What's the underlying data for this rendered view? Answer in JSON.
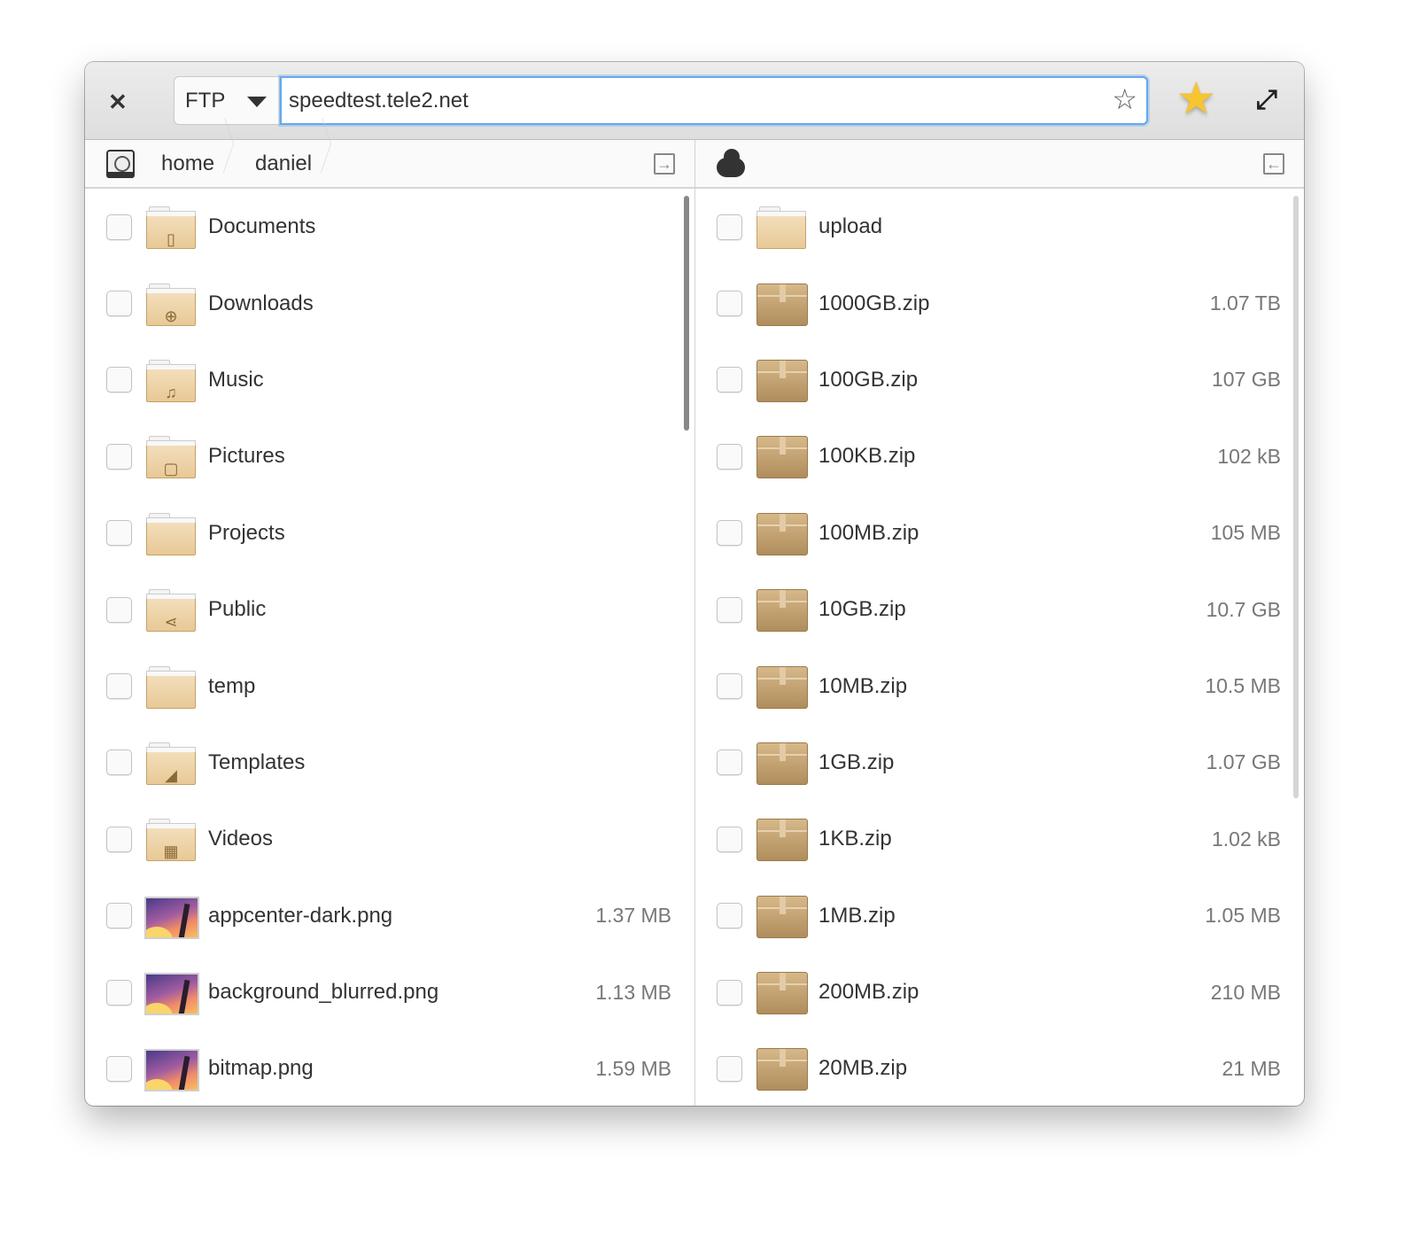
{
  "header": {
    "close_icon": "close-icon",
    "protocol": "FTP",
    "url": "speedtest.tele2.net",
    "bookmark_icon": "star-outline-icon",
    "bookmarks_icon": "star-filled-icon",
    "maximize_icon": "maximize-icon",
    "accent_color": "#64a8ef"
  },
  "left_pane": {
    "breadcrumb": [
      "home",
      "daniel"
    ],
    "scroll_fraction": 0.25,
    "items": [
      {
        "name": "Documents",
        "type": "folder",
        "glyph": "▯",
        "size": ""
      },
      {
        "name": "Downloads",
        "type": "folder",
        "glyph": "⊕",
        "size": ""
      },
      {
        "name": "Music",
        "type": "folder",
        "glyph": "♫",
        "size": ""
      },
      {
        "name": "Pictures",
        "type": "folder",
        "glyph": "▢",
        "size": ""
      },
      {
        "name": "Projects",
        "type": "folder",
        "glyph": "",
        "size": ""
      },
      {
        "name": "Public",
        "type": "folder",
        "glyph": "⋖",
        "size": ""
      },
      {
        "name": "temp",
        "type": "folder",
        "glyph": "",
        "size": ""
      },
      {
        "name": "Templates",
        "type": "folder",
        "glyph": "◢",
        "size": ""
      },
      {
        "name": "Videos",
        "type": "folder",
        "glyph": "▦",
        "size": ""
      },
      {
        "name": "appcenter-dark.png",
        "type": "image",
        "glyph": "",
        "size": "1.37 MB"
      },
      {
        "name": "background_blurred.png",
        "type": "image",
        "glyph": "",
        "size": "1.13 MB"
      },
      {
        "name": "bitmap.png",
        "type": "image",
        "glyph": "",
        "size": "1.59 MB"
      }
    ]
  },
  "right_pane": {
    "location_icon": "cloud-icon",
    "scroll_fraction": 0.66,
    "items": [
      {
        "name": "upload",
        "type": "folder",
        "glyph": "",
        "size": ""
      },
      {
        "name": "1000GB.zip",
        "type": "archive",
        "glyph": "",
        "size": "1.07 TB"
      },
      {
        "name": "100GB.zip",
        "type": "archive",
        "glyph": "",
        "size": "107 GB"
      },
      {
        "name": "100KB.zip",
        "type": "archive",
        "glyph": "",
        "size": "102 kB"
      },
      {
        "name": "100MB.zip",
        "type": "archive",
        "glyph": "",
        "size": "105 MB"
      },
      {
        "name": "10GB.zip",
        "type": "archive",
        "glyph": "",
        "size": "10.7 GB"
      },
      {
        "name": "10MB.zip",
        "type": "archive",
        "glyph": "",
        "size": "10.5 MB"
      },
      {
        "name": "1GB.zip",
        "type": "archive",
        "glyph": "",
        "size": "1.07 GB"
      },
      {
        "name": "1KB.zip",
        "type": "archive",
        "glyph": "",
        "size": "1.02 kB"
      },
      {
        "name": "1MB.zip",
        "type": "archive",
        "glyph": "",
        "size": "1.05 MB"
      },
      {
        "name": "200MB.zip",
        "type": "archive",
        "glyph": "",
        "size": "210 MB"
      },
      {
        "name": "20MB.zip",
        "type": "archive",
        "glyph": "",
        "size": "21 MB"
      }
    ]
  }
}
